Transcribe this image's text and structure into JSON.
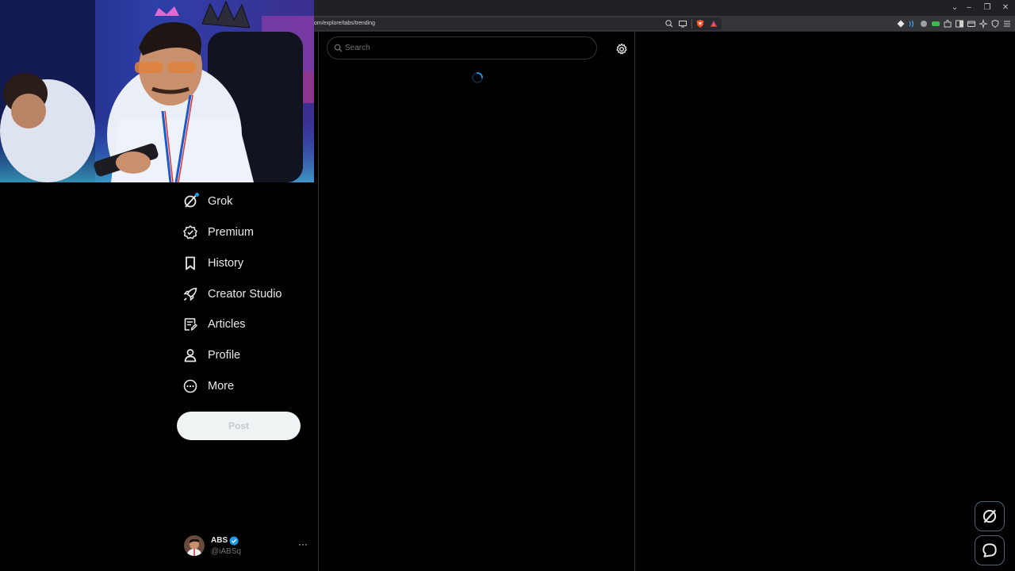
{
  "browser": {
    "url": "om/explore/tabs/trending",
    "window_controls": {
      "minimize": "–",
      "restore": "❐",
      "close": "✕",
      "dropdown": "⌄"
    }
  },
  "nav": {
    "items": [
      {
        "label": "Grok",
        "icon": "grok-icon"
      },
      {
        "label": "Premium",
        "icon": "premium-icon"
      },
      {
        "label": "History",
        "icon": "bookmark-icon"
      },
      {
        "label": "Creator Studio",
        "icon": "rocket-icon"
      },
      {
        "label": "Articles",
        "icon": "articles-icon"
      },
      {
        "label": "Profile",
        "icon": "profile-icon"
      },
      {
        "label": "More",
        "icon": "more-circle-icon"
      }
    ],
    "post_label": "Post"
  },
  "account": {
    "name": "ABS",
    "handle": "@iABSq",
    "more": "···"
  },
  "search": {
    "placeholder": "Search",
    "value": ""
  },
  "colors": {
    "accent": "#1d9bf0",
    "background": "#000000",
    "border": "#2f3336"
  }
}
